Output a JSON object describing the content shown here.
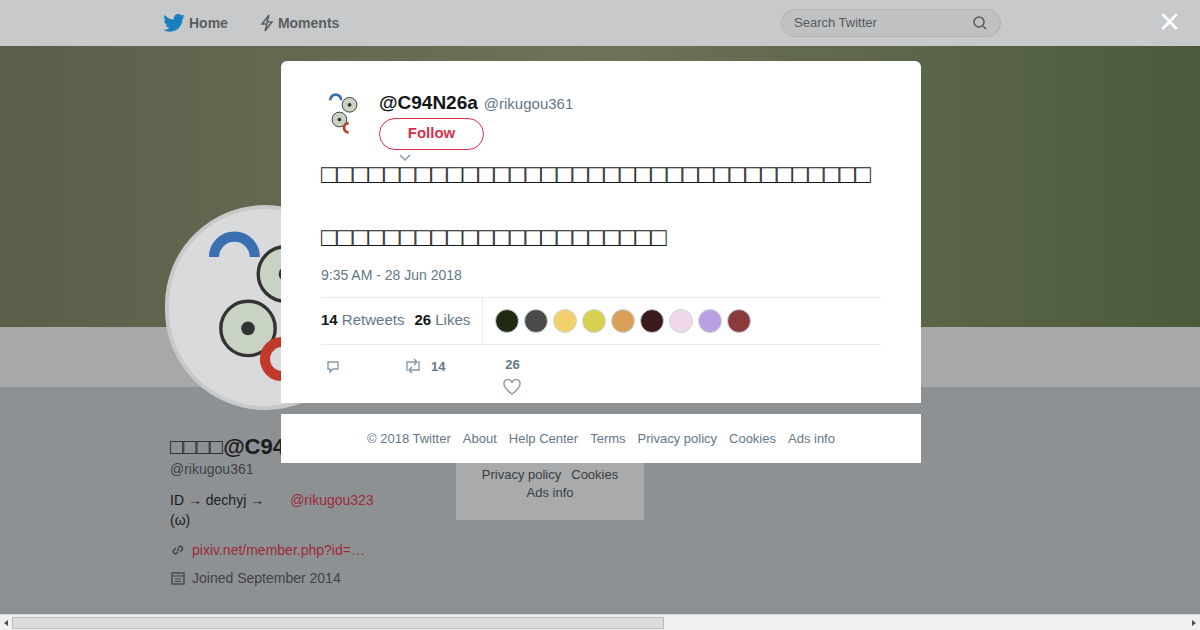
{
  "nav": {
    "items": [
      "Home",
      "Moments"
    ],
    "search_placeholder": "Search Twitter",
    "close": "×"
  },
  "profile": {
    "name": "□□□□@C94",
    "handle": "@rikugou361",
    "bio": "ID → dechyj  →",
    "bio_link": "@rikugou323",
    "bio_line2": "(ω)",
    "url": "pixiv.net/member.php?id=…",
    "joined": "Joined September 2014"
  },
  "side_footer": [
    "Privacy policy",
    "Cookies",
    "Ads info"
  ],
  "tweet": {
    "display_name": "@C94N26a",
    "handle": "@rikugou361",
    "follow": "Follow",
    "lines": [
      "□□□□□□□□□□□□□□□□□□□□□□□□□□□□□□□□□□□",
      "□□□□□□□□□□□□□□□□□□□□□□"
    ],
    "time": "9:35 AM - 28 Jun 2018",
    "retweets": "14",
    "retweets_label": "Retweets",
    "likes": "26",
    "likes_label": "Likes",
    "likers": [
      {
        "color": "#1f2a10"
      },
      {
        "color": "#4a4a4a"
      },
      {
        "color": "#f2d06b"
      },
      {
        "color": "#d8d050"
      },
      {
        "color": "#d9a05a"
      },
      {
        "color": "#3a1a1a"
      },
      {
        "color": "#f0d8e8"
      },
      {
        "color": "#b9a0e0"
      },
      {
        "color": "#8a3a3a"
      }
    ],
    "actions": {
      "retweet_count": "14",
      "like_count": "26"
    }
  },
  "footer": [
    "© 2018 Twitter",
    "About",
    "Help Center",
    "Terms",
    "Privacy policy",
    "Cookies",
    "Ads info"
  ]
}
